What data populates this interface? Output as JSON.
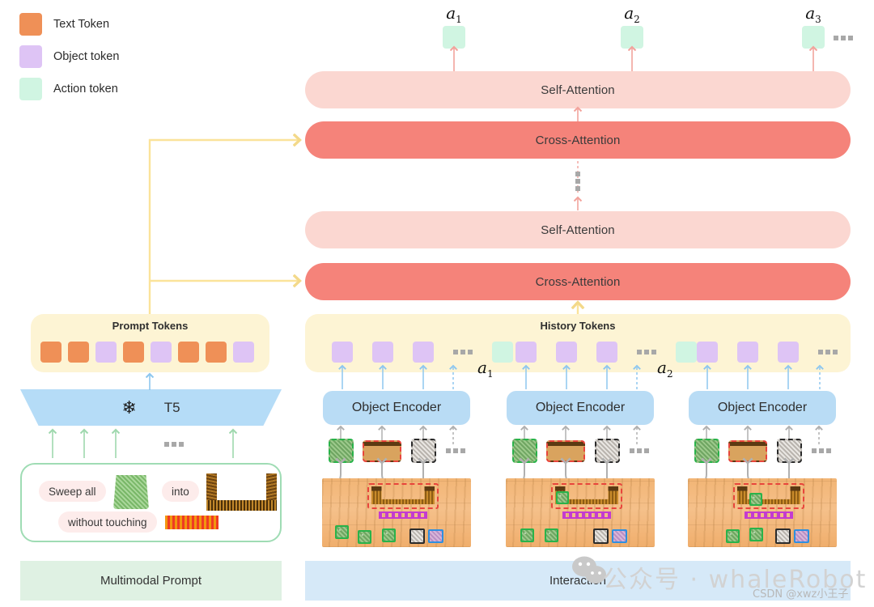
{
  "legend": {
    "items": [
      {
        "label": "Text Token",
        "color": "#ef9057",
        "icon": "orange-square-icon"
      },
      {
        "label": "Object token",
        "color": "#dec4f5",
        "icon": "purple-square-icon"
      },
      {
        "label": "Action token",
        "color": "#d0f5e2",
        "icon": "green-square-icon"
      }
    ]
  },
  "action_outputs": [
    {
      "label": "a",
      "sub": "1"
    },
    {
      "label": "a",
      "sub": "2"
    },
    {
      "label": "a",
      "sub": "3"
    }
  ],
  "decoder": {
    "blocks": [
      {
        "label": "Self-Attention",
        "type": "self",
        "color": "#fbd7d1"
      },
      {
        "label": "Cross-Attention",
        "type": "cross",
        "color": "#f5837a"
      },
      {
        "label": "Self-Attention",
        "type": "self",
        "color": "#fbd7d1"
      },
      {
        "label": "Cross-Attention",
        "type": "cross",
        "color": "#f5837a"
      }
    ],
    "stack_ellipsis": "vertical-dots"
  },
  "prompt_tokens": {
    "title": "Prompt Tokens",
    "tokens": [
      "text",
      "text",
      "object",
      "text",
      "object",
      "text",
      "text",
      "object"
    ],
    "panel_color": "#fdf4d4"
  },
  "history_tokens": {
    "title": "History Tokens",
    "tokens": [
      {
        "type": "object"
      },
      {
        "type": "object"
      },
      {
        "type": "object"
      },
      {
        "type": "ellipsis"
      },
      {
        "type": "action",
        "label": "a",
        "sub": "1"
      },
      {
        "type": "object"
      },
      {
        "type": "object"
      },
      {
        "type": "object"
      },
      {
        "type": "ellipsis"
      },
      {
        "type": "action",
        "label": "a",
        "sub": "2"
      },
      {
        "type": "object"
      },
      {
        "type": "object"
      },
      {
        "type": "object"
      },
      {
        "type": "ellipsis"
      }
    ],
    "panel_color": "#fdf4d4"
  },
  "text_encoder": {
    "label": "T5",
    "frozen_icon": "snowflake-icon",
    "frozen_glyph": "❄",
    "color": "#b5dcf7"
  },
  "object_encoders": [
    {
      "label": "Object Encoder"
    },
    {
      "label": "Object Encoder"
    },
    {
      "label": "Object Encoder"
    }
  ],
  "multimodal_prompt": {
    "pills": [
      "Sweep all",
      "into",
      "without touching"
    ],
    "images": [
      "green-block-image",
      "pan-image",
      "orange-stripe-block-image"
    ],
    "footer_label": "Multimodal Prompt",
    "footer_color": "#dff1e3",
    "border_color": "#9fdcb4"
  },
  "interaction": {
    "footer_label": "Interaction",
    "footer_color": "#d6e9f8",
    "scenes": [
      {
        "name": "scene-step-1"
      },
      {
        "name": "scene-step-2"
      },
      {
        "name": "scene-step-3"
      }
    ]
  },
  "watermark": {
    "text": "公众号 · whaleRobot",
    "icon": "wechat-icon",
    "credit": "CSDN @xwz小王子",
    "color": "#d2d2d2"
  }
}
